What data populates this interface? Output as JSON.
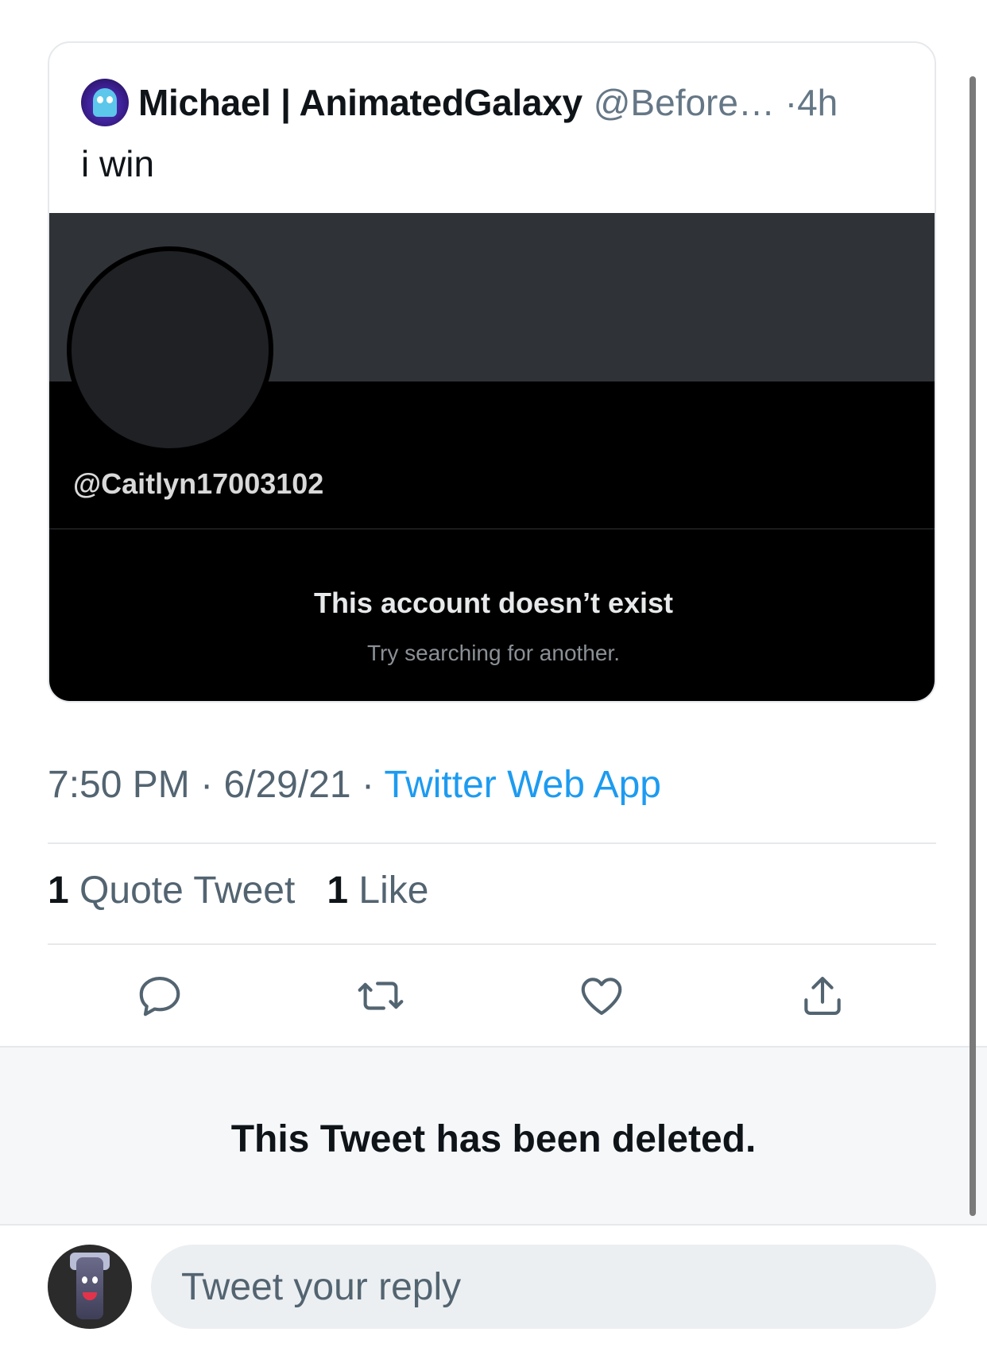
{
  "quote_tweet": {
    "author_name": "Michael | AnimatedGalaxy",
    "author_handle": "@Before…",
    "separator": "·",
    "time_ago": "4h",
    "text": "i win",
    "media": {
      "handle": "@Caitlyn17003102",
      "title": "This account doesn’t exist",
      "subtitle": "Try searching for another."
    }
  },
  "meta": {
    "time": "7:50 PM",
    "date": "6/29/21",
    "separator": "·",
    "source": "Twitter Web App"
  },
  "stats": {
    "quote_count": "1",
    "quote_label": "Quote Tweet",
    "like_count": "1",
    "like_label": "Like"
  },
  "actions": {
    "icons": [
      "reply-icon",
      "retweet-icon",
      "like-icon",
      "share-icon"
    ]
  },
  "deleted_tweet": {
    "text": "This Tweet has been deleted."
  },
  "reply": {
    "placeholder": "Tweet your reply"
  },
  "colors": {
    "link": "#1d9bf0",
    "secondary_text": "#536471",
    "icon": "#536471"
  }
}
